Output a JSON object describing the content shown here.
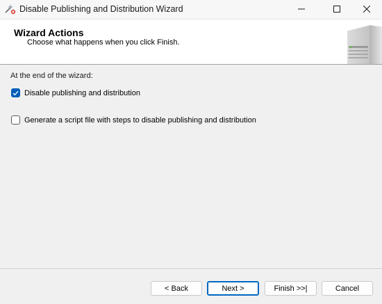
{
  "window": {
    "title": "Disable Publishing and Distribution Wizard",
    "icon": "wizard-wand-icon"
  },
  "header": {
    "title": "Wizard Actions",
    "subtitle": "Choose what happens when you click Finish.",
    "graphic": "server-icon"
  },
  "body": {
    "section_label": "At the end of the wizard:",
    "options": [
      {
        "label": "Disable publishing and distribution",
        "checked": true
      },
      {
        "label": "Generate a script file with steps to disable publishing and distribution",
        "checked": false
      }
    ]
  },
  "footer": {
    "back_label": "< Back",
    "next_label": "Next >",
    "finish_label": "Finish >>|",
    "cancel_label": "Cancel"
  },
  "colors": {
    "accent": "#005fb8",
    "window_bg": "#f0f0f0",
    "header_bg": "#ffffff"
  }
}
